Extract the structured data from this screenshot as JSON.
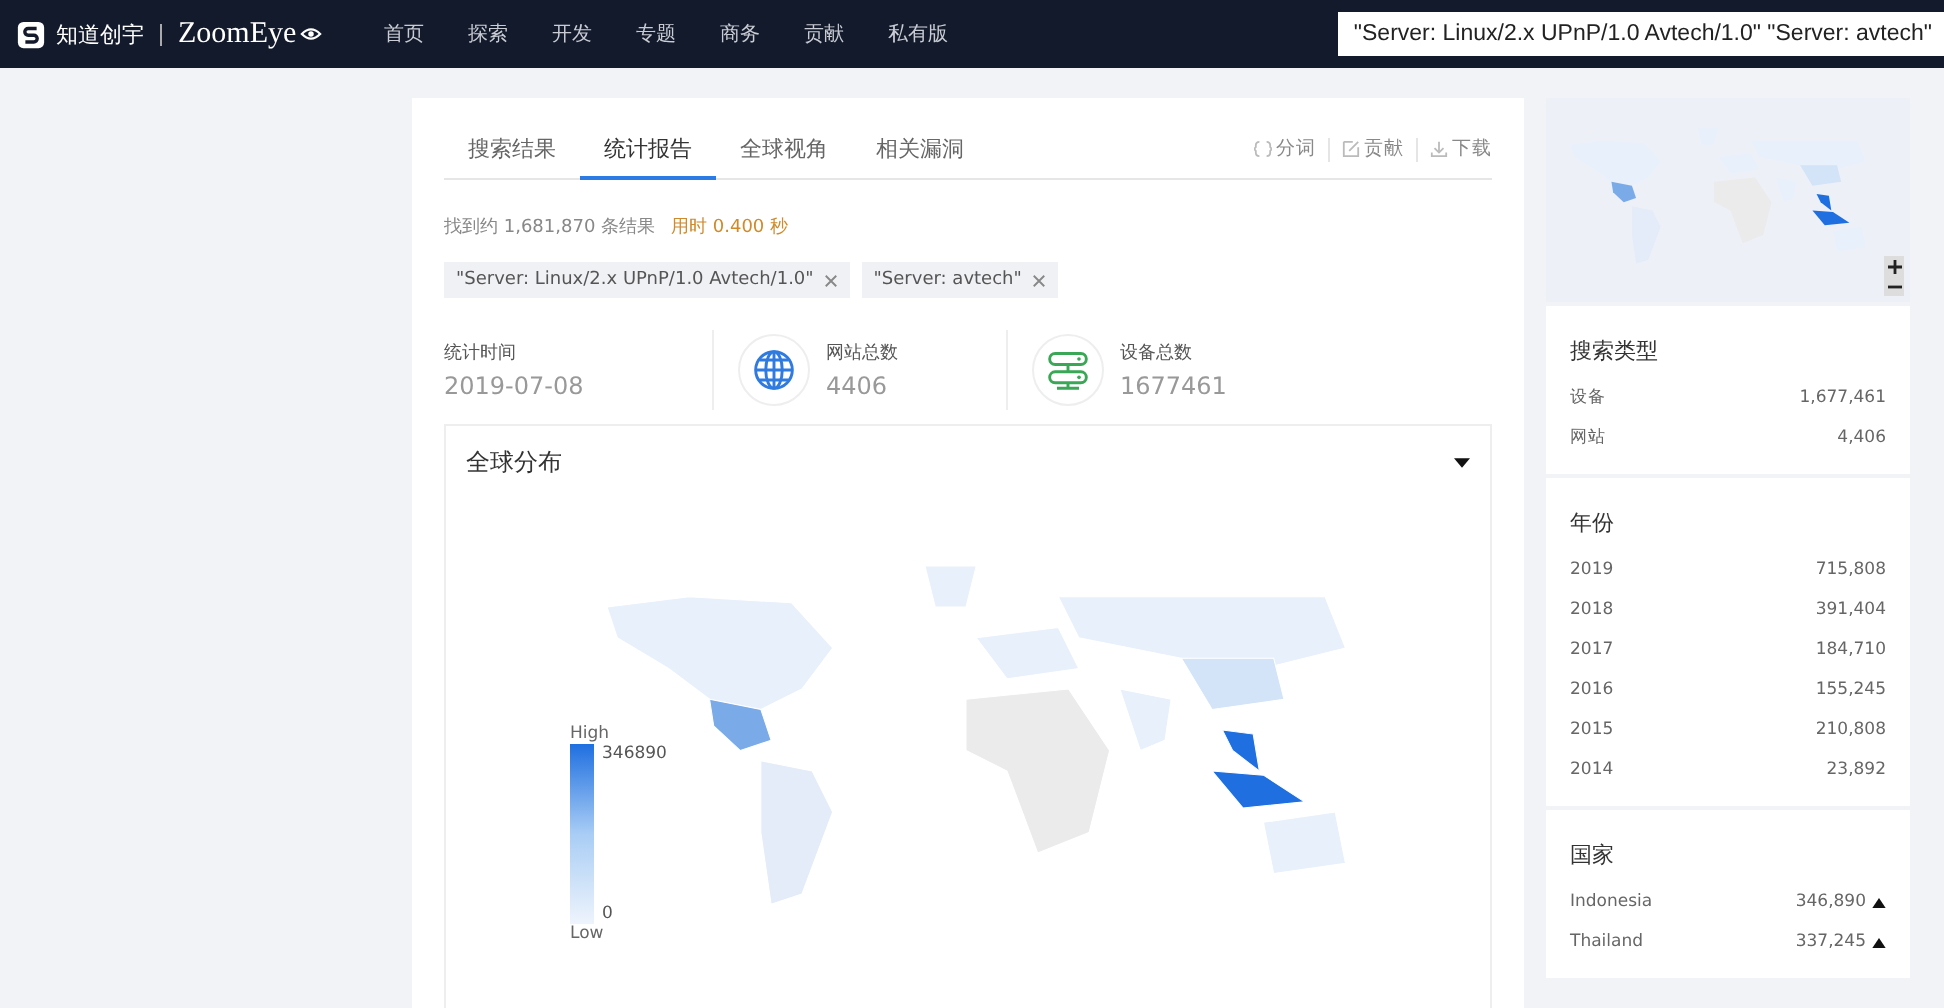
{
  "nav": {
    "brand": "知道创宇",
    "product": "ZoomEye",
    "links": [
      "首页",
      "探索",
      "开发",
      "专题",
      "商务",
      "贡献",
      "私有版"
    ],
    "query": "\"Server: Linux/2.x UPnP/1.0 Avtech/1.0\" \"Server: avtech\""
  },
  "tabs": [
    {
      "label": "搜索结果",
      "selected": false
    },
    {
      "label": "统计报告",
      "selected": true
    },
    {
      "label": "全球视角",
      "selected": false
    },
    {
      "label": "相关漏洞",
      "selected": false
    }
  ],
  "actions": [
    {
      "kind": "segment",
      "label": "分词"
    },
    {
      "kind": "edit",
      "label": "贡献"
    },
    {
      "kind": "download",
      "label": "下载"
    }
  ],
  "summary": {
    "found": "找到约 1,681,870 条结果",
    "time": "用时 0.400 秒"
  },
  "filters": [
    "\"Server: Linux/2.x UPnP/1.0 Avtech/1.0\"",
    "\"Server: avtech\""
  ],
  "stats": [
    {
      "kind": "plain",
      "label": "统计时间",
      "value": "2019-07-08"
    },
    {
      "kind": "globe",
      "label": "网站总数",
      "value": "4406"
    },
    {
      "kind": "server",
      "label": "设备总数",
      "value": "1677461"
    }
  ],
  "map_panel": {
    "title": "全球分布",
    "legend": {
      "high": "High",
      "max": "346890",
      "low": "Low",
      "min": "0"
    }
  },
  "sidebar": [
    {
      "title": "搜索类型",
      "items": [
        {
          "label": "设备",
          "value": "1,677,461"
        },
        {
          "label": "网站",
          "value": "4,406"
        }
      ]
    },
    {
      "title": "年份",
      "items": [
        {
          "label": "2019",
          "value": "715,808"
        },
        {
          "label": "2018",
          "value": "391,404"
        },
        {
          "label": "2017",
          "value": "184,710"
        },
        {
          "label": "2016",
          "value": "155,245"
        },
        {
          "label": "2015",
          "value": "210,808"
        },
        {
          "label": "2014",
          "value": "23,892"
        }
      ]
    },
    {
      "title": "国家",
      "kind": "ranked",
      "items": [
        {
          "label": "Indonesia",
          "value": "346,890"
        },
        {
          "label": "Thailand",
          "value": "337,245"
        }
      ]
    }
  ]
}
